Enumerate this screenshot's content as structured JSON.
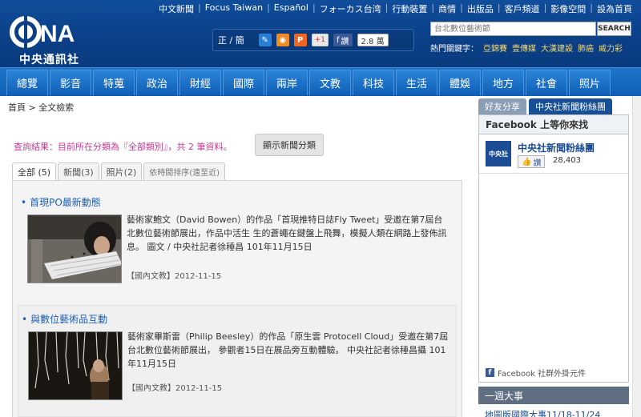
{
  "header": {
    "logo_text": "中央通訊社",
    "top_links": [
      "中文新聞",
      "Focus Taiwan",
      "Español",
      "フォーカス台湾",
      "行動裝置",
      "商情",
      "出版品",
      "客戶頻道",
      "影像空間",
      "設為首頁"
    ],
    "tools": {
      "trad_simp": "正 / 簡",
      "gplus": "+1",
      "fb_like": "讚",
      "fb_count": "2.8 萬"
    },
    "search": {
      "placeholder": "台北數位藝術節",
      "button": "SEARCH"
    },
    "hot_keywords": {
      "label": "熱門關鍵字：",
      "items": [
        "亞錦賽",
        "壹傳媒",
        "大漢建設",
        "肺癌",
        "威力彩"
      ]
    }
  },
  "nav": [
    "總覽",
    "影音",
    "特蒐",
    "政治",
    "財經",
    "國際",
    "兩岸",
    "文教",
    "科技",
    "生活",
    "體娛",
    "地方",
    "社會",
    "照片"
  ],
  "breadcrumb": "首頁 > 全文檢索",
  "query": {
    "result_text": "查詢結果：目前所在分類為『全部類別』，共 2 筆資料。",
    "show_category_button": "顯示新聞分類"
  },
  "tabs": [
    "全部 (5)",
    "新聞(3)",
    "照片(2)",
    "依時間排序(遠至近)"
  ],
  "entries": [
    {
      "title": "首現PO最新動態",
      "body": "藝術家鮑文（David Bowen）的作品「首現推特日誌Fly Tweet」受邀在第7屆台北數位藝術節展出，作品中活生 生的蒼蠅在鍵盤上飛舞，模擬人類在網路上發佈訊息。 圖文 / 中央社記者徐䅜昌 101年11月15日",
      "meta": "【國內文教】2012-11-15"
    },
    {
      "title": "與數位藝術品互動",
      "body": "藝術家畢斯雷（Philip Beesley）的作品「原生雲 Protocell Cloud」受邀在第7屆台北數位藝術節展出， 參觀者15日在展品旁互動體驗。 中央社記者徐䅜昌攝 101年11月15日",
      "meta": "【國內文教】2012-11-15"
    }
  ],
  "sidebar": {
    "tabs": [
      "好友分享",
      "中央社新聞粉絲團"
    ],
    "fb_header": "Facebook 上等你來找",
    "fb_page_name": "中央社新聞粉絲團",
    "fb_logo_text": "中央社",
    "fb_like": "讚",
    "fb_likes": "28,403",
    "fb_plugin": "Facebook 社群外掛元件",
    "week_header": "一週大事",
    "week_item": "地圖版國際大事11/18-11/24"
  },
  "colors": {
    "header_bg": "#0b3f86",
    "nav_bg": "#1670c5",
    "result_text": "#c03c93",
    "link": "#1a5fb4"
  }
}
